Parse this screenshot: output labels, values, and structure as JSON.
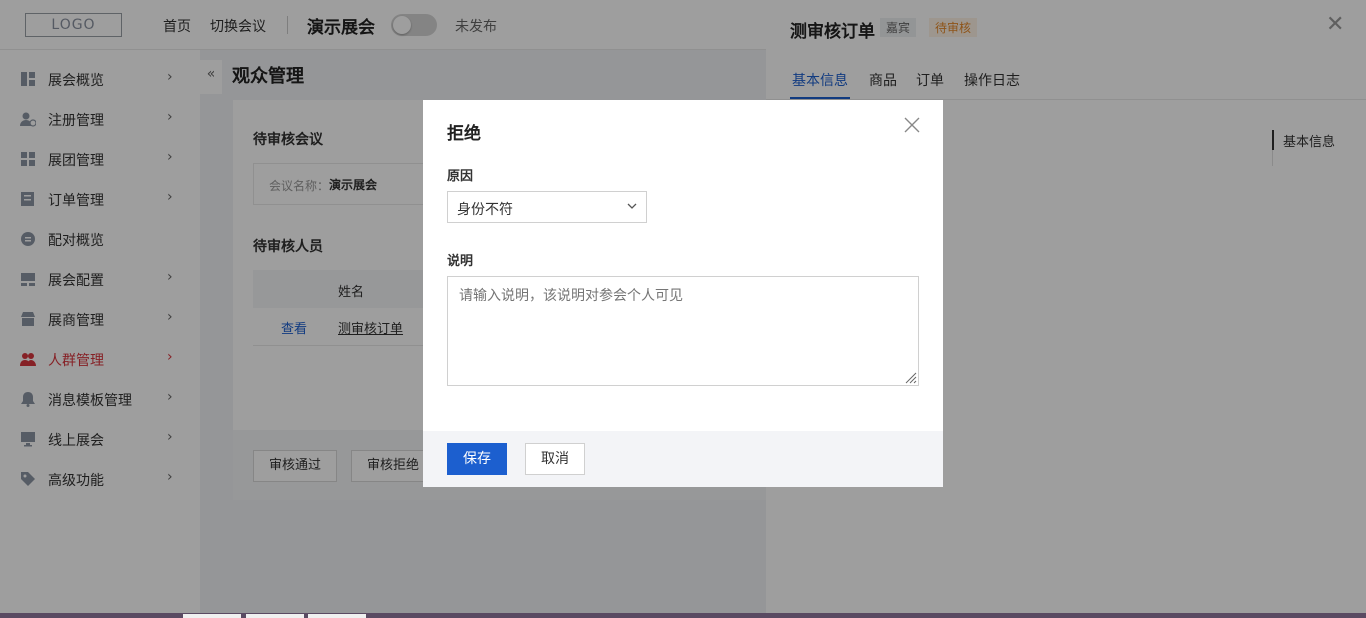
{
  "topbar": {
    "logo": "LOGO",
    "home": "首页",
    "switch_meeting": "切换会议",
    "event_name": "演示展会",
    "publish_status": "未发布"
  },
  "sidebar": {
    "items": [
      {
        "label": "展会概览",
        "icon": "dashboard-icon",
        "has_arrow": true
      },
      {
        "label": "注册管理",
        "icon": "user-register-icon",
        "has_arrow": true
      },
      {
        "label": "展团管理",
        "icon": "group-icon",
        "has_arrow": true
      },
      {
        "label": "订单管理",
        "icon": "order-icon",
        "has_arrow": true
      },
      {
        "label": "配对概览",
        "icon": "match-icon",
        "has_arrow": false
      },
      {
        "label": "展会配置",
        "icon": "config-icon",
        "has_arrow": true
      },
      {
        "label": "展商管理",
        "icon": "store-icon",
        "has_arrow": true
      },
      {
        "label": "人群管理",
        "icon": "people-icon",
        "has_arrow": true,
        "active": true
      },
      {
        "label": "消息模板管理",
        "icon": "bell-icon",
        "has_arrow": true
      },
      {
        "label": "线上展会",
        "icon": "monitor-icon",
        "has_arrow": true
      },
      {
        "label": "高级功能",
        "icon": "tag-icon",
        "has_arrow": true
      }
    ],
    "chevron": "›",
    "collapse": "«"
  },
  "main": {
    "page_title": "观众管理",
    "pending_meeting_title": "待审核会议",
    "meeting_name_key": "会议名称：",
    "meeting_name_value": "演示展会",
    "pending_people_title": "待审核人员",
    "table_header_name": "姓名",
    "row_action": "查看",
    "row_name": "测审核订单",
    "approve_button": "审核通过",
    "reject_button": "审核拒绝"
  },
  "drawer": {
    "title": "测审核订单",
    "tag_guest": "嘉宾",
    "tag_status": "待审核",
    "close": "✕",
    "tabs": [
      "基本信息",
      "商品",
      "订单",
      "操作日志"
    ],
    "anchor": "基本信息"
  },
  "modal": {
    "title": "拒绝",
    "reason_label": "原因",
    "reason_value": "身份不符",
    "note_label": "说明",
    "note_placeholder": "请输入说明，该说明对参会个人可见",
    "save": "保存",
    "cancel": "取消"
  },
  "colors": {
    "primary": "#1c5fcf",
    "active_nav": "#d9363e",
    "pending_tag": "#e6892a"
  }
}
